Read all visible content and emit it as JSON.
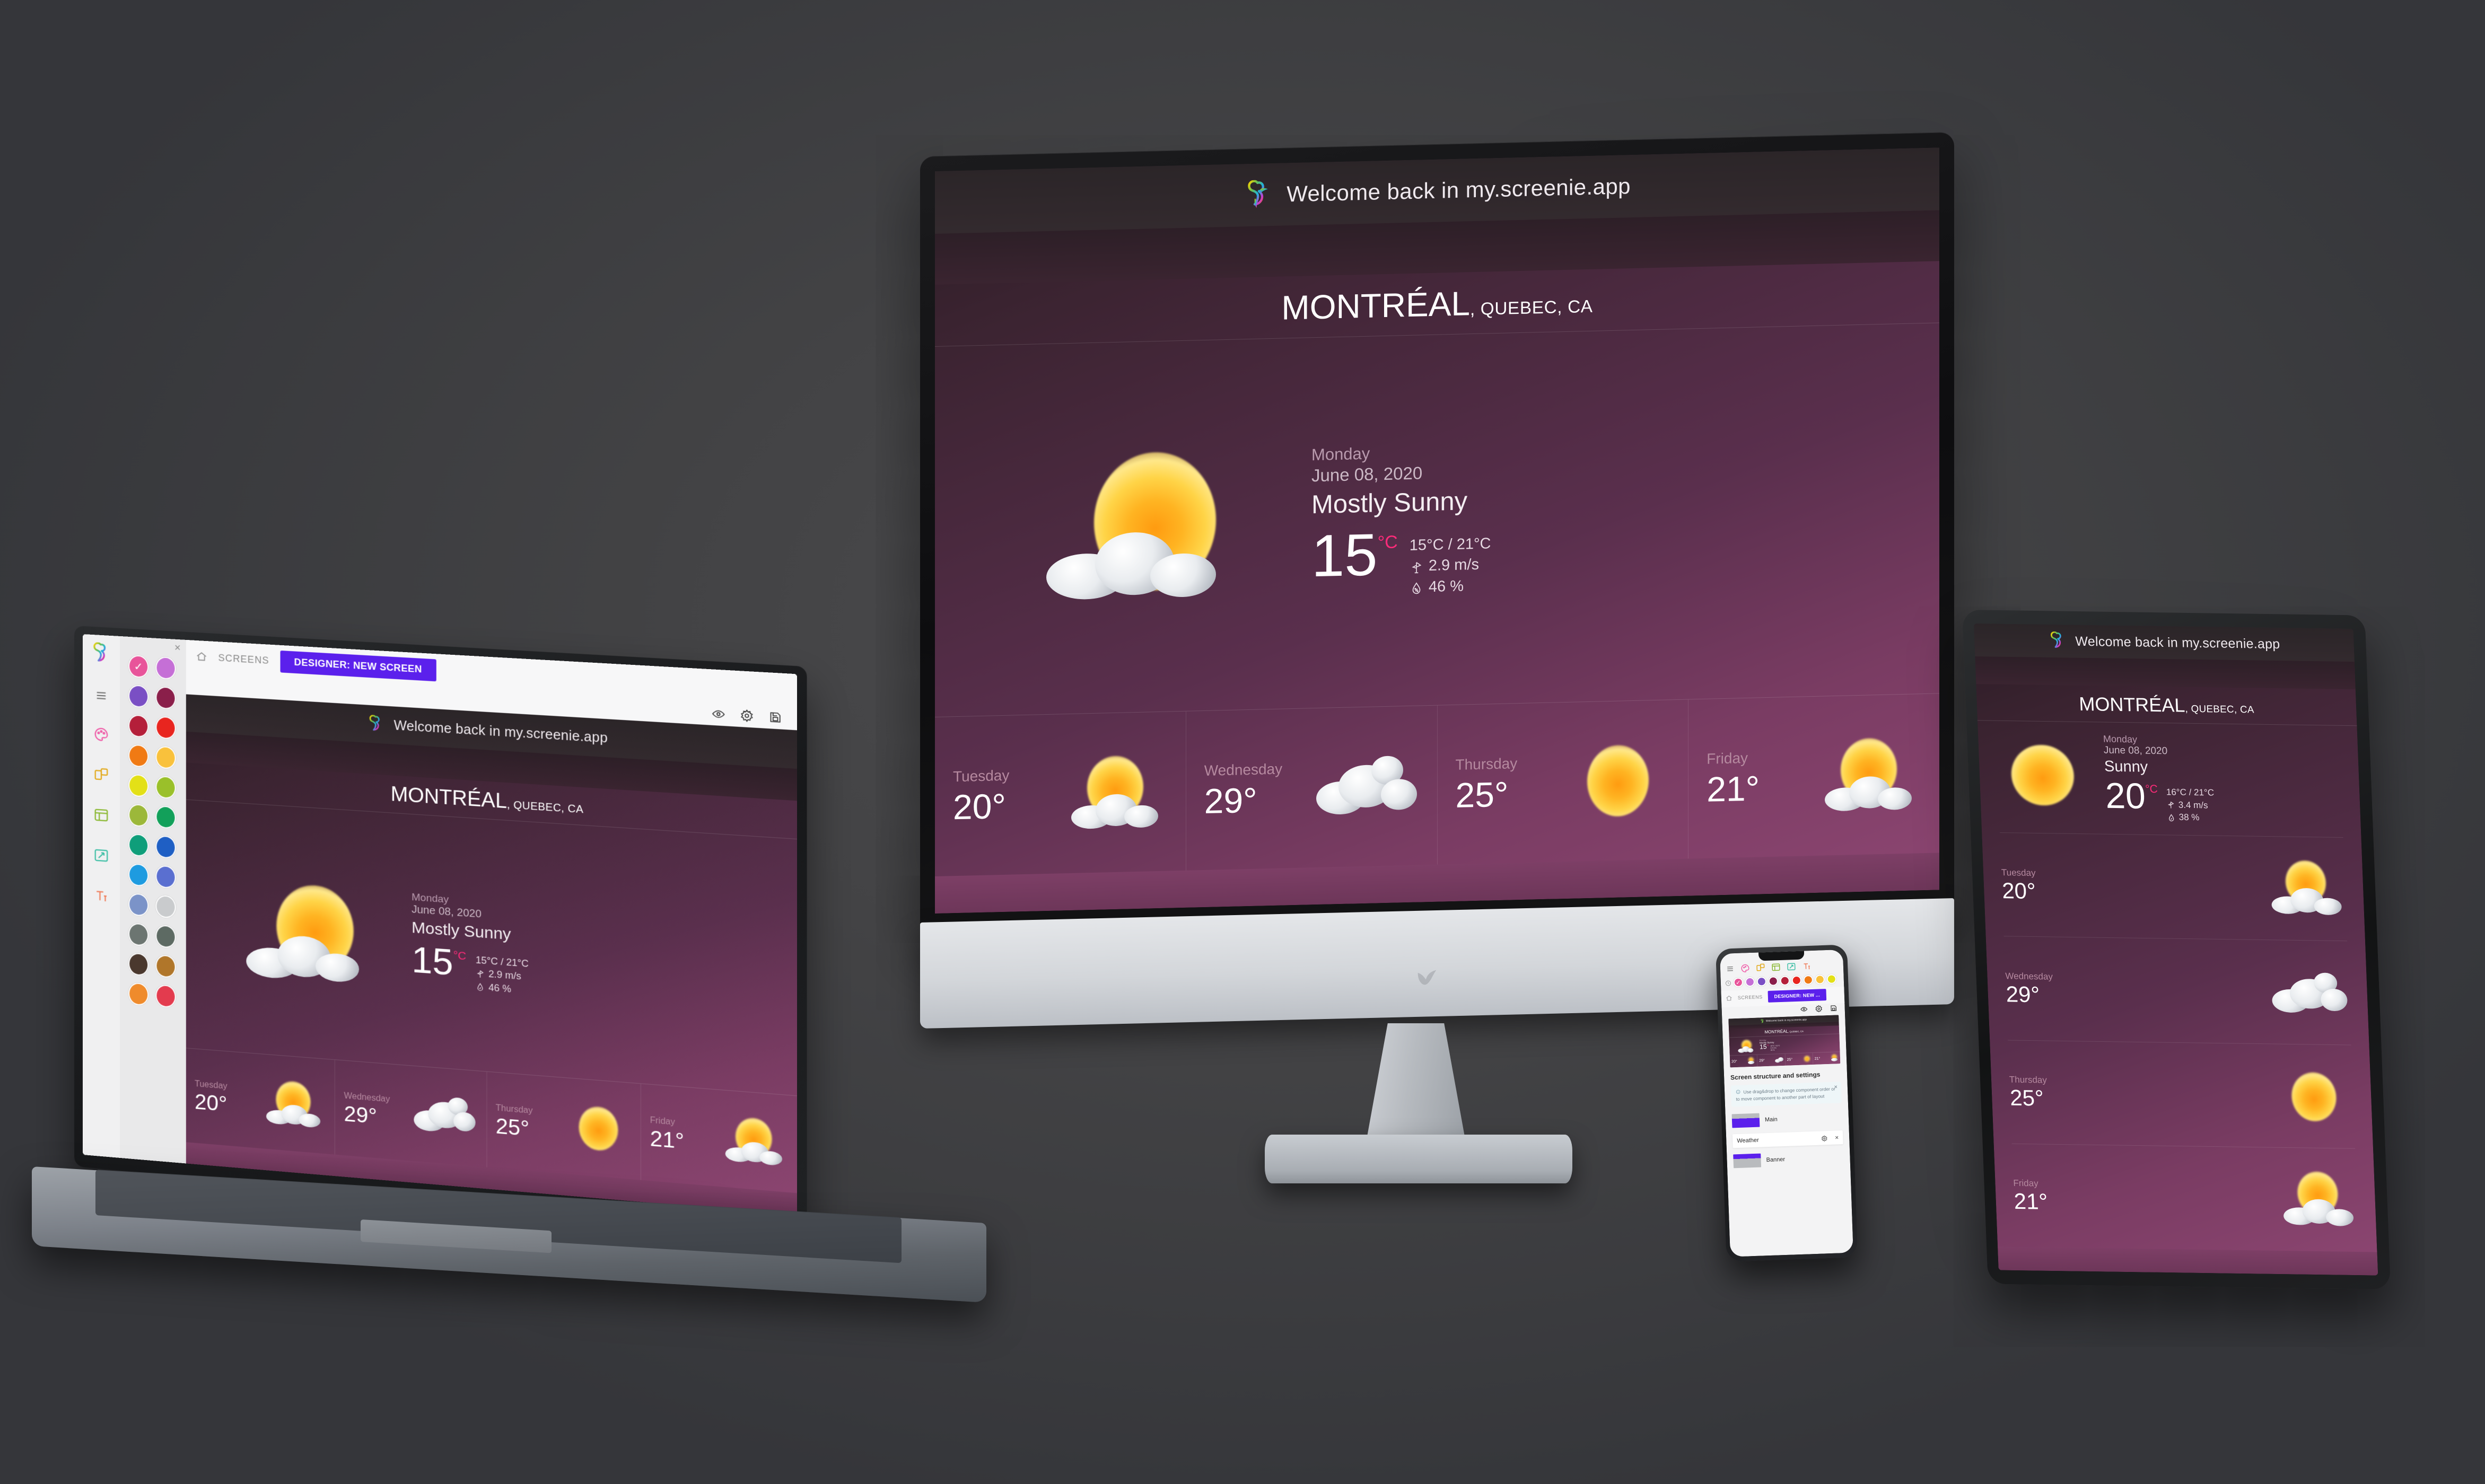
{
  "app": {
    "brand_name": "screenie",
    "header_text": "Welcome back in my.screenie.app",
    "logo_icon": "hummingbird-logo-icon"
  },
  "weather": {
    "city": "MONTRÉAL",
    "region": ", QUEBEC, CA",
    "desktop": {
      "day": "Monday",
      "date": "June 08, 2020",
      "condition": "Mostly Sunny",
      "temp": "15",
      "unit": "°C",
      "range": "15°C / 21°C",
      "wind": "2.9 m/s",
      "humidity": "46 %",
      "icon": "sun-behind-cloud-icon",
      "wind_icon": "wind-vane-icon",
      "humidity_icon": "water-drop-percent-icon"
    },
    "tablet": {
      "day": "Monday",
      "date": "June 08, 2020",
      "condition": "Sunny",
      "temp": "20",
      "unit": "°C",
      "range": "16°C / 21°C",
      "wind": "3.4 m/s",
      "humidity": "38 %",
      "icon": "sun-icon",
      "wind_icon": "wind-vane-icon",
      "humidity_icon": "water-drop-percent-icon"
    },
    "forecast": [
      {
        "day": "Tuesday",
        "temp": "20°",
        "icon": "sun-behind-cloud-icon"
      },
      {
        "day": "Wednesday",
        "temp": "29°",
        "icon": "cloud-icon"
      },
      {
        "day": "Thursday",
        "temp": "25°",
        "icon": "sun-icon"
      },
      {
        "day": "Friday",
        "temp": "21°",
        "icon": "sun-behind-cloud-icon"
      }
    ]
  },
  "designer": {
    "screens_label": "SCREENS",
    "new_screen_button": "DESIGNER: NEW SCREEN",
    "new_screen_button_short": "DESIGNER: NEW ...",
    "close_label": "×",
    "home_icon": "home-icon",
    "menu_icon": "hamburger-menu-icon",
    "preview_icon": "eye-preview-icon",
    "settings_icon": "gear-settings-icon",
    "save_icon": "save-disk-icon",
    "tool_icons": [
      "palette-icon",
      "components-icon",
      "layout-grid-icon",
      "resize-icon",
      "typography-icon"
    ],
    "panel_title": "Screen structure and settings",
    "tip_icon": "info-circle-icon",
    "tip_text": "Use drag&drop to change component order or to move component to another part of layout",
    "tip_close": "×",
    "components": [
      {
        "name": "Main",
        "thumb": "banner-top-thumb"
      },
      {
        "name": "Weather",
        "thumb": ""
      },
      {
        "name": "Banner",
        "thumb": "banner-bottom-thumb"
      }
    ],
    "component_settings_icon": "gear-settings-icon",
    "component_remove_icon": "close-x-icon",
    "palette": [
      "#e8549a",
      "#c56fd6",
      "#7a4fc4",
      "#8a1f4a",
      "#b41f3a",
      "#e8251f",
      "#f07a14",
      "#f9c13c",
      "#e3e017",
      "#9ac02a",
      "#9cb83a",
      "#12a05a",
      "#0f9e7a",
      "#1f5fc4",
      "#1e9be0",
      "#5a6fd0",
      "#7b93c8",
      "#c9cbcd",
      "#6c7571",
      "#5d6a63",
      "#4a382e",
      "#b0762a",
      "#ef8b2c",
      "#e33b4e"
    ],
    "selected_swatch_index": 0,
    "selected_check_icon": "check-icon"
  },
  "colors": {
    "accent_purple": "#5b20ec",
    "accent_pink": "#ff2b7a",
    "scene_background": "#434345",
    "app_plum": "#7a3c63"
  }
}
